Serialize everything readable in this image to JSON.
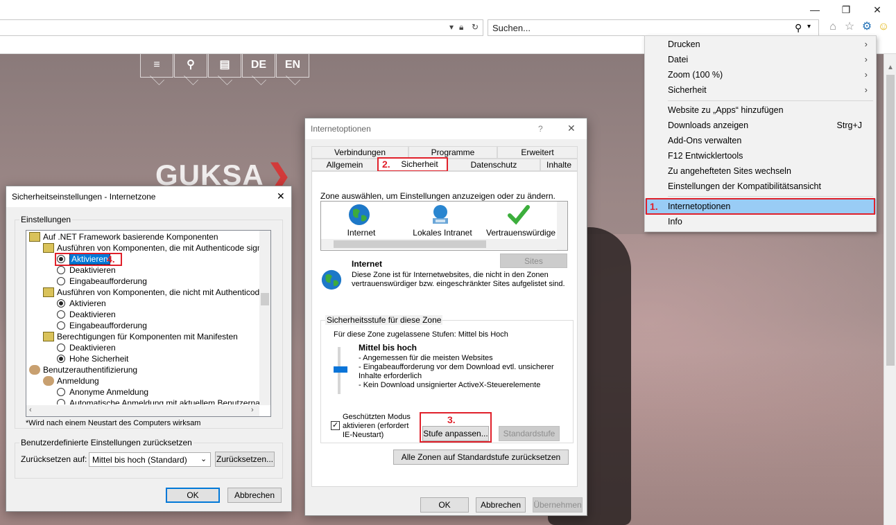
{
  "browser": {
    "search_placeholder": "Suchen...",
    "window_controls": {
      "minimize": "—",
      "restore": "❐",
      "close": "✕"
    },
    "toolbar_icons": [
      "home-icon",
      "favorites-star-icon",
      "gear-icon",
      "smiley-icon"
    ]
  },
  "website": {
    "nav": [
      "≡",
      "⚲",
      "▤",
      "DE",
      "EN"
    ],
    "logo": "GUKSA",
    "logo_mark": "❯",
    "accent": "#d23a3a"
  },
  "tools_menu": {
    "items": [
      {
        "label": "Drucken",
        "submenu": true
      },
      {
        "label": "Datei",
        "submenu": true
      },
      {
        "label": "Zoom (100 %)",
        "submenu": true
      },
      {
        "label": "Sicherheit",
        "submenu": true
      },
      {
        "label": "Website zu „Apps“ hinzufügen"
      },
      {
        "label": "Downloads anzeigen",
        "shortcut": "Strg+J"
      },
      {
        "label": "Add-Ons verwalten"
      },
      {
        "label": "F12 Entwicklertools"
      },
      {
        "label": "Zu angehefteten Sites wechseln"
      },
      {
        "label": "Einstellungen der Kompatibilitätsansicht"
      },
      {
        "label": "Internetoptionen",
        "selected": true
      },
      {
        "label": "Info"
      }
    ],
    "arrow": "›",
    "step": "1."
  },
  "internet_options": {
    "title": "Internetoptionen",
    "help": "?",
    "close": "✕",
    "tabs_row1": [
      "Verbindungen",
      "Programme",
      "Erweitert"
    ],
    "tabs_row2": [
      "Allgemein",
      "Sicherheit",
      "Datenschutz",
      "Inhalte"
    ],
    "active_tab_step": "2.",
    "zone_prompt": "Zone auswählen, um Einstellungen anzuzeigen oder zu ändern.",
    "zones": [
      "Internet",
      "Lokales Intranet",
      "Vertrauenswürdige"
    ],
    "zone_title": "Internet",
    "sites_button": "Sites",
    "zone_desc": "Diese Zone ist für Internetwebsites, die nicht in den Zonen vertrauenswürdiger bzw. eingeschränkter Sites aufgelistet sind.",
    "level_group": "Sicherheitsstufe für diese Zone",
    "allowed_levels": "Für diese Zone zugelassene Stufen: Mittel bis Hoch",
    "level_name": "Mittel bis hoch",
    "level_points": [
      "- Angemessen für die meisten Websites",
      "- Eingabeaufforderung vor dem Download evtl. unsicherer Inhalte erforderlich",
      "- Kein Download unsignierter ActiveX-Steuerelemente"
    ],
    "protected_mode": "Geschützten Modus aktivieren (erfordert IE-Neustart)",
    "custom_level_button": "Stufe anpassen...",
    "custom_step": "3.",
    "default_level_button": "Standardstufe",
    "reset_all_button": "Alle Zonen auf Standardstufe zurücksetzen",
    "ok": "OK",
    "cancel": "Abbrechen",
    "apply": "Übernehmen"
  },
  "security_settings": {
    "title": "Sicherheitseinstellungen - Internetzone",
    "close": "✕",
    "group": "Einstellungen",
    "tree": [
      {
        "label": "Auf .NET Framework basierende Komponenten",
        "type": "category",
        "level": 0
      },
      {
        "label": "Ausführen von Komponenten, die mit Authenticode signiert s",
        "type": "category",
        "level": 1
      },
      {
        "label": "Aktivieren",
        "type": "radio",
        "checked": true,
        "selected": true,
        "level": 2
      },
      {
        "label": "Deaktivieren",
        "type": "radio",
        "level": 2
      },
      {
        "label": "Eingabeaufforderung",
        "type": "radio",
        "level": 2
      },
      {
        "label": "Ausführen von Komponenten, die nicht mit Authenticode sign",
        "type": "category",
        "level": 1
      },
      {
        "label": "Aktivieren",
        "type": "radio",
        "checked": true,
        "level": 2
      },
      {
        "label": "Deaktivieren",
        "type": "radio",
        "level": 2
      },
      {
        "label": "Eingabeaufforderung",
        "type": "radio",
        "level": 2
      },
      {
        "label": "Berechtigungen für Komponenten mit Manifesten",
        "type": "category",
        "level": 1
      },
      {
        "label": "Deaktivieren",
        "type": "radio",
        "level": 2
      },
      {
        "label": "Hohe Sicherheit",
        "type": "radio",
        "checked": true,
        "level": 2
      },
      {
        "label": "Benutzerauthentifizierung",
        "type": "user",
        "level": 0
      },
      {
        "label": "Anmeldung",
        "type": "user",
        "level": 1
      },
      {
        "label": "Anonyme Anmeldung",
        "type": "radio",
        "level": 2
      },
      {
        "label": "Automatische Anmeldung mit aktuellem Benutzernamen u",
        "type": "radio",
        "level": 2
      }
    ],
    "selected_step": "4.",
    "restart_note": "*Wird nach einem Neustart des Computers wirksam",
    "reset_group": "Benutzerdefinierte Einstellungen zurücksetzen",
    "reset_label": "Zurücksetzen auf:",
    "reset_value": "Mittel bis hoch (Standard)",
    "reset_button": "Zurücksetzen...",
    "ok": "OK",
    "cancel": "Abbrechen"
  }
}
